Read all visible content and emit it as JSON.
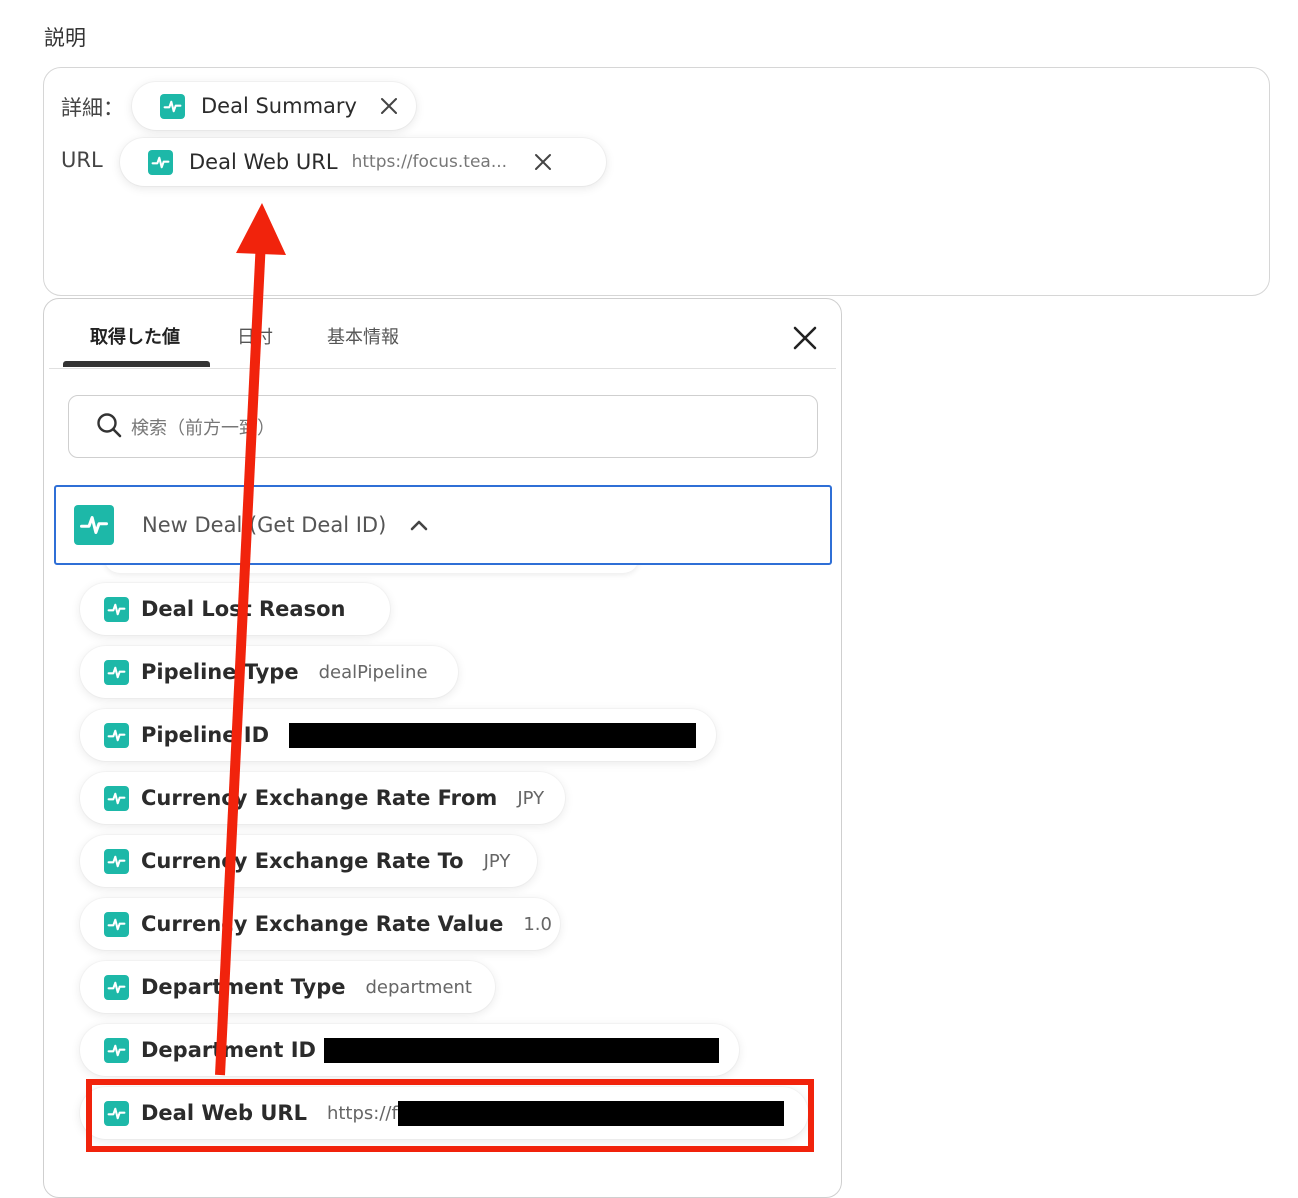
{
  "description": {
    "label": "説明",
    "rows": [
      {
        "label": "詳細：",
        "chip": {
          "label": "Deal Summary",
          "value": ""
        }
      },
      {
        "label": "URL",
        "chip": {
          "label": "Deal Web URL",
          "value": "https://focus.tea..."
        }
      }
    ]
  },
  "panel": {
    "tabs": [
      "取得した値",
      "日付",
      "基本情報"
    ],
    "active_tab": 0,
    "search_placeholder": "検索（前方一致）",
    "group": {
      "title": "New Deal (Get Deal ID)",
      "expanded": true
    },
    "items": [
      {
        "label": "Deal Lost Reason",
        "value": ""
      },
      {
        "label": "Pipeline Type",
        "value": "dealPipeline"
      },
      {
        "label": "Pipeline ID",
        "value": "",
        "redacted": true
      },
      {
        "label": "Currency Exchange Rate From",
        "value": "JPY"
      },
      {
        "label": "Currency Exchange Rate To",
        "value": "JPY"
      },
      {
        "label": "Currency Exchange Rate Value",
        "value": "1.0"
      },
      {
        "label": "Department Type",
        "value": "department"
      },
      {
        "label": "Department ID",
        "value": "",
        "redacted": true
      },
      {
        "label": "Deal Web URL",
        "value": "https://f",
        "redacted": true,
        "highlighted": true
      }
    ]
  },
  "icons": {
    "app": "app-logo-icon",
    "remove": "close-icon",
    "search": "search-icon",
    "collapse": "chevron-up-icon"
  },
  "colors": {
    "accent_teal": "#1db8a8",
    "focus_border": "#2f6fd6",
    "annotation_red": "#f1230c"
  }
}
